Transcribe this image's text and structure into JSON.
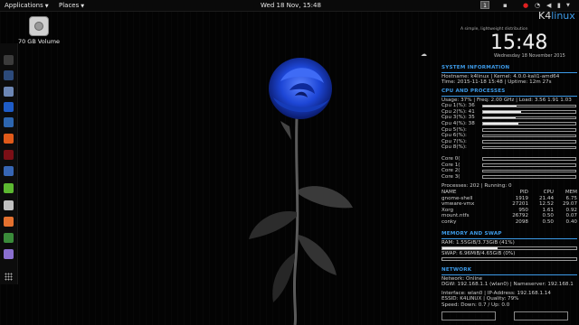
{
  "topbar": {
    "applications": "Applications",
    "places": "Places",
    "clock": "Wed 18 Nov, 15:48",
    "workspace": "1"
  },
  "desktop": {
    "icon_label": "70 GB Volume"
  },
  "conky": {
    "brand_k4": "K4",
    "brand_linux": "linux",
    "tagline": "A simple, lightweight distribution",
    "time": "15:48",
    "date": "Wednesday 18 November 2015",
    "system": {
      "header": "SYSTEM INFORMATION",
      "hostname": "Hostname: k4linux  | Kernel: 4.0.0-kali1-amd64",
      "time": "Time: 2015-11-18 15:48  | Uptime: 12m 27s"
    },
    "cpu": {
      "header": "CPU AND PROCESSES",
      "usage": "Usage: 37%  | Freq: 2.00 GHz | Load: 3.56 1.91 1.03",
      "cpus": [
        {
          "label": "Cpu  1(%): 36",
          "value": 36
        },
        {
          "label": "Cpu  2(%): 41",
          "value": 41
        },
        {
          "label": "Cpu  3(%): 35",
          "value": 35
        },
        {
          "label": "Cpu  4(%): 38",
          "value": 38
        },
        {
          "label": "Cpu  5(%):",
          "value": 0
        },
        {
          "label": "Cpu  6(%):",
          "value": 0
        },
        {
          "label": "Cpu  7(%):",
          "value": 0
        },
        {
          "label": "Cpu  8(%):",
          "value": 0
        }
      ],
      "cores": [
        {
          "label": "Core 0(",
          "value": 0
        },
        {
          "label": "Core 1(",
          "value": 0
        },
        {
          "label": "Core 2(",
          "value": 0
        },
        {
          "label": "Core 3(",
          "value": 0
        }
      ],
      "processes": "Processes: 202  | Running: 0",
      "table_headers": [
        "NAME",
        "PID",
        "CPU",
        "MEM"
      ],
      "table": [
        [
          "gnome-shell",
          "1919",
          "21.44",
          "6.75"
        ],
        [
          "vmware-vmx",
          "27201",
          "12.52",
          "29.07"
        ],
        [
          "Xorg",
          "950",
          "1.61",
          "0.92"
        ],
        [
          "mount.ntfs",
          "26792",
          "0.50",
          "0.07"
        ],
        [
          "conky",
          "2098",
          "0.50",
          "0.40"
        ]
      ]
    },
    "memory": {
      "header": "MEMORY AND SWAP",
      "ram": "RAM:  1.55GiB/3.73GiB (41%)",
      "ram_pct": 41,
      "swap": "SWAP: 6.96MiB/4.65GiB (0%)",
      "swap_pct": 0
    },
    "network": {
      "header": "NETWORK",
      "status": "Network:  Online",
      "dgw": "DGW: 192.168.1.1 (wlan0) | Nameserver: 192.168.1",
      "iface": "Interface: wlan0 | IP-Address: 192.168.1.14",
      "essid": "ESSID: K4LINUX | Quality: 79%",
      "speed": "Speed: Down: 0.7 / Up: 0.0"
    }
  },
  "colors": {
    "accent": "#3d9be9",
    "rose": "#1d46d6"
  }
}
